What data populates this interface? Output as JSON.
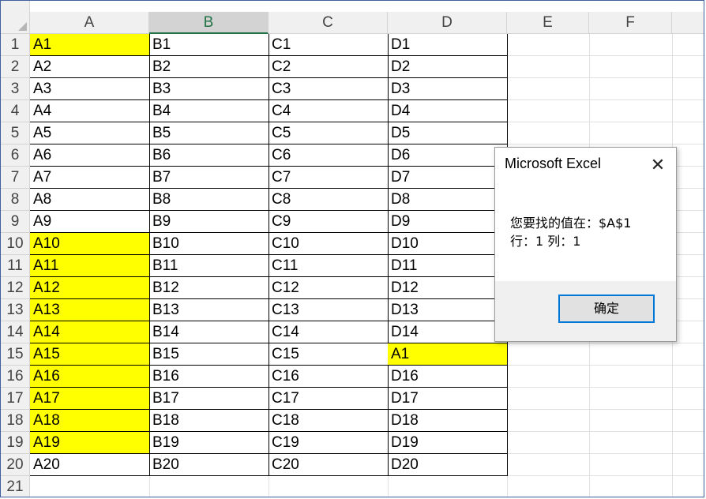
{
  "columns": [
    "A",
    "B",
    "C",
    "D",
    "E",
    "F"
  ],
  "selected_column": "B",
  "row_numbers": [
    "1",
    "2",
    "3",
    "4",
    "5",
    "6",
    "7",
    "8",
    "9",
    "10",
    "11",
    "12",
    "13",
    "14",
    "15",
    "16",
    "17",
    "18",
    "19",
    "20",
    "21"
  ],
  "rows": [
    [
      "A1",
      "B1",
      "C1",
      "D1"
    ],
    [
      "A2",
      "B2",
      "C2",
      "D2"
    ],
    [
      "A3",
      "B3",
      "C3",
      "D3"
    ],
    [
      "A4",
      "B4",
      "C4",
      "D4"
    ],
    [
      "A5",
      "B5",
      "C5",
      "D5"
    ],
    [
      "A6",
      "B6",
      "C6",
      "D6"
    ],
    [
      "A7",
      "B7",
      "C7",
      "D7"
    ],
    [
      "A8",
      "B8",
      "C8",
      "D8"
    ],
    [
      "A9",
      "B9",
      "C9",
      "D9"
    ],
    [
      "A10",
      "B10",
      "C10",
      "D10"
    ],
    [
      "A11",
      "B11",
      "C11",
      "D11"
    ],
    [
      "A12",
      "B12",
      "C12",
      "D12"
    ],
    [
      "A13",
      "B13",
      "C13",
      "D13"
    ],
    [
      "A14",
      "B14",
      "C14",
      "D14"
    ],
    [
      "A15",
      "B15",
      "C15",
      "A1"
    ],
    [
      "A16",
      "B16",
      "C16",
      "D16"
    ],
    [
      "A17",
      "B17",
      "C17",
      "D17"
    ],
    [
      "A18",
      "B18",
      "C18",
      "D18"
    ],
    [
      "A19",
      "B19",
      "C19",
      "D19"
    ],
    [
      "A20",
      "B20",
      "C20",
      "D20"
    ]
  ],
  "highlighted_cells": [
    "A1",
    "A10",
    "A11",
    "A12",
    "A13",
    "A14",
    "A15",
    "A16",
    "A17",
    "A18",
    "A19",
    "D15"
  ],
  "highlight_color": "#ffff00",
  "dialog": {
    "title": "Microsoft Excel",
    "close_symbol": "✕",
    "message_line1": "您要找的值在：$A$1",
    "message_line2": "行：1 列：1",
    "ok_label": "确定"
  }
}
